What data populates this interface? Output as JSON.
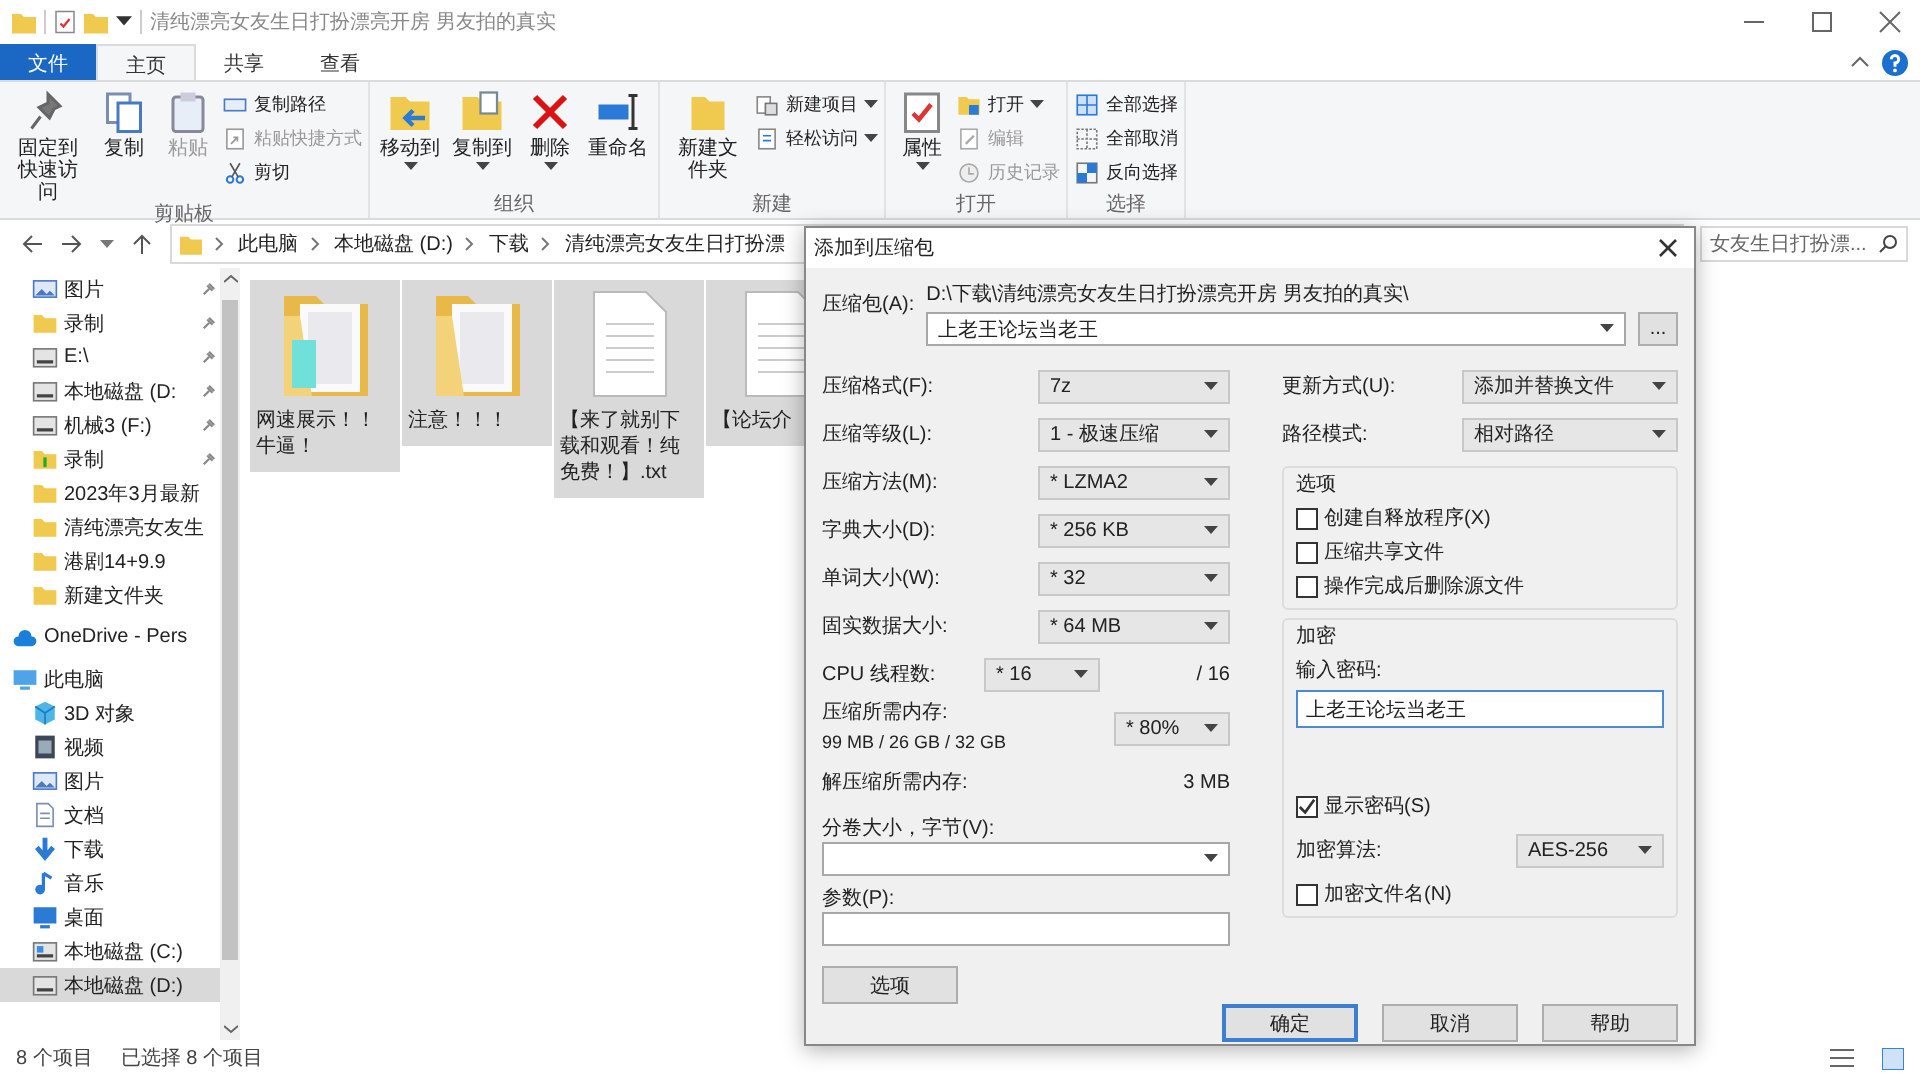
{
  "window": {
    "title": "清纯漂亮女友生日打扮漂亮开房 男友拍的真实"
  },
  "ribbon_tabs": [
    {
      "label": "文件",
      "kind": "file",
      "selected": false
    },
    {
      "label": "主页",
      "kind": "tab",
      "selected": true
    },
    {
      "label": "共享",
      "kind": "tab",
      "selected": false
    },
    {
      "label": "查看",
      "kind": "tab",
      "selected": false
    }
  ],
  "ribbon_groups": [
    {
      "label": "剪贴板",
      "large": [
        {
          "label": "固定到快速访问",
          "disabled": false,
          "dropdown": false
        },
        {
          "label": "复制",
          "disabled": false,
          "dropdown": false
        },
        {
          "label": "粘贴",
          "disabled": true,
          "dropdown": false
        }
      ],
      "small": [
        {
          "label": "复制路径",
          "disabled": false,
          "dropdown": false
        },
        {
          "label": "粘贴快捷方式",
          "disabled": true,
          "dropdown": false
        },
        {
          "label": "剪切",
          "disabled": false,
          "dropdown": false
        }
      ]
    },
    {
      "label": "组织",
      "large": [
        {
          "label": "移动到",
          "disabled": false,
          "dropdown": true
        },
        {
          "label": "复制到",
          "disabled": false,
          "dropdown": true
        },
        {
          "label": "删除",
          "disabled": false,
          "dropdown": true
        },
        {
          "label": "重命名",
          "disabled": false,
          "dropdown": false
        }
      ]
    },
    {
      "label": "新建",
      "large": [
        {
          "label": "新建文件夹",
          "disabled": false,
          "dropdown": false
        }
      ],
      "small": [
        {
          "label": "新建项目",
          "disabled": false,
          "dropdown": true
        },
        {
          "label": "轻松访问",
          "disabled": false,
          "dropdown": true
        }
      ]
    },
    {
      "label": "打开",
      "large": [
        {
          "label": "属性",
          "disabled": false,
          "dropdown": true
        }
      ],
      "small": [
        {
          "label": "打开",
          "disabled": false,
          "dropdown": true
        },
        {
          "label": "编辑",
          "disabled": true,
          "dropdown": false
        },
        {
          "label": "历史记录",
          "disabled": true,
          "dropdown": false
        }
      ]
    },
    {
      "label": "选择",
      "small": [
        {
          "label": "全部选择",
          "disabled": false,
          "dropdown": false
        },
        {
          "label": "全部取消",
          "disabled": false,
          "dropdown": false
        },
        {
          "label": "反向选择",
          "disabled": false,
          "dropdown": false
        }
      ]
    }
  ],
  "address_bar": {
    "crumbs": [
      "此电脑",
      "本地磁盘 (D:)",
      "下载",
      "清纯漂亮女友生日打扮漂"
    ]
  },
  "search": {
    "placeholder": "女友生日打扮漂..."
  },
  "sidebar": {
    "quick_access": [
      {
        "label": "图片",
        "pinned": true
      },
      {
        "label": "录制",
        "pinned": true
      },
      {
        "label": "E:\\",
        "pinned": true
      },
      {
        "label": "本地磁盘 (D:",
        "pinned": true
      },
      {
        "label": "机械3 (F:)",
        "pinned": true
      },
      {
        "label": "录制",
        "pinned": true
      },
      {
        "label": "2023年3月最新",
        "pinned": false
      },
      {
        "label": "清纯漂亮女友生",
        "pinned": false
      },
      {
        "label": "港剧14+9.9",
        "pinned": false
      },
      {
        "label": "新建文件夹",
        "pinned": false
      }
    ],
    "onedrive": {
      "label": "OneDrive - Pers"
    },
    "this_pc": {
      "label": "此电脑",
      "children": [
        {
          "label": "3D 对象",
          "selected": false
        },
        {
          "label": "视频",
          "selected": false
        },
        {
          "label": "图片",
          "selected": false
        },
        {
          "label": "文档",
          "selected": false
        },
        {
          "label": "下载",
          "selected": false
        },
        {
          "label": "音乐",
          "selected": false
        },
        {
          "label": "桌面",
          "selected": false
        },
        {
          "label": "本地磁盘 (C:)",
          "selected": false
        },
        {
          "label": "本地磁盘 (D:)",
          "selected": true
        }
      ]
    }
  },
  "files": [
    {
      "name": "网速展示！！牛逼！",
      "kind": "folder",
      "selected": true
    },
    {
      "name": "注意！！！",
      "kind": "folder",
      "selected": true
    },
    {
      "name": "【来了就别下载和观看！纯免费！】.txt",
      "kind": "text",
      "selected": true
    },
    {
      "name": "【论坛介",
      "kind": "text",
      "selected": true
    }
  ],
  "status_bar": {
    "count": "8 个项目",
    "selected": "已选择 8 个项目"
  },
  "dialog": {
    "title": "添加到压缩包",
    "archive_label": "压缩包(A):",
    "archive_path": "D:\\下载\\清纯漂亮女友生日打扮漂亮开房 男友拍的真实\\",
    "archive_name": "上老王论坛当老王",
    "browse": "...",
    "left": [
      {
        "kind": "select",
        "label": "压缩格式(F):",
        "value": "7z"
      },
      {
        "kind": "select",
        "label": "压缩等级(L):",
        "value": "1 - 极速压缩"
      },
      {
        "kind": "select",
        "label": "压缩方法(M):",
        "value": "* LZMA2"
      },
      {
        "kind": "select",
        "label": "字典大小(D):",
        "value": "* 256 KB"
      },
      {
        "kind": "select",
        "label": "单词大小(W):",
        "value": "* 32"
      },
      {
        "kind": "select",
        "label": "固实数据大小:",
        "value": "* 64 MB"
      },
      {
        "kind": "threads",
        "label": "CPU 线程数:",
        "value": "* 16",
        "extra": "/ 16"
      },
      {
        "kind": "memory",
        "label": "压缩所需内存:",
        "note": "99 MB / 26 GB / 32 GB",
        "value": "* 80%"
      },
      {
        "kind": "text",
        "label": "解压缩所需内存:",
        "value": "3 MB"
      }
    ],
    "volume_label": "分卷大小，字节(V):",
    "params_label": "参数(P):",
    "options_button": "选项",
    "right": [
      {
        "label": "更新方式(U):",
        "value": "添加并替换文件"
      },
      {
        "label": "路径模式:",
        "value": "相对路径"
      }
    ],
    "options": {
      "title": "选项",
      "checks": [
        {
          "label": "创建自释放程序(X)",
          "checked": false
        },
        {
          "label": "压缩共享文件",
          "checked": false
        },
        {
          "label": "操作完成后删除源文件",
          "checked": false
        }
      ]
    },
    "encryption": {
      "title": "加密",
      "password_label": "输入密码:",
      "password": "上老王论坛当老王",
      "show_password": {
        "label": "显示密码(S)",
        "checked": true
      },
      "method_label": "加密算法:",
      "method": "AES-256",
      "encrypt_names": {
        "label": "加密文件名(N)",
        "checked": false
      }
    },
    "buttons": [
      {
        "label": "确定",
        "default": true
      },
      {
        "label": "取消",
        "default": false
      },
      {
        "label": "帮助",
        "default": false
      }
    ]
  }
}
